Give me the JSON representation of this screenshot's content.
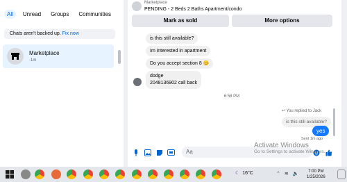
{
  "left": {
    "tabs": [
      "All",
      "Unread",
      "Groups",
      "Communities"
    ],
    "backup": {
      "text": "Chats aren't backed up.",
      "link": "Fix now"
    },
    "conversation": {
      "name": "Marketplace",
      "time": "·1m"
    }
  },
  "chat": {
    "marketplace_label": "Marketplace",
    "listing_title": "PENDING - 2 Beds 2 Baths Apartment/condo",
    "mark_as_sold": "Mark as sold",
    "more_options": "More options",
    "messages": [
      "is this still available?",
      "Im interested in apartment",
      "Do you accept section 8 😊",
      "dodge",
      "2048136902 call back"
    ],
    "time_divider": "6:58 PM",
    "replied_to": "You replied to Jack",
    "quoted": "is this still available?",
    "reply": "yes",
    "sent_status": "Sent 1m ago",
    "input_placeholder": "Aa"
  },
  "watermark": {
    "title": "Activate Windows",
    "subtitle": "Go to Settings to activate Windows."
  },
  "taskbar": {
    "temperature": "16°C",
    "time": "7:00 PM",
    "date": "1/25/2026"
  },
  "colors": {
    "accent": "#0064d1",
    "bubble_blue": "#1677ff"
  }
}
